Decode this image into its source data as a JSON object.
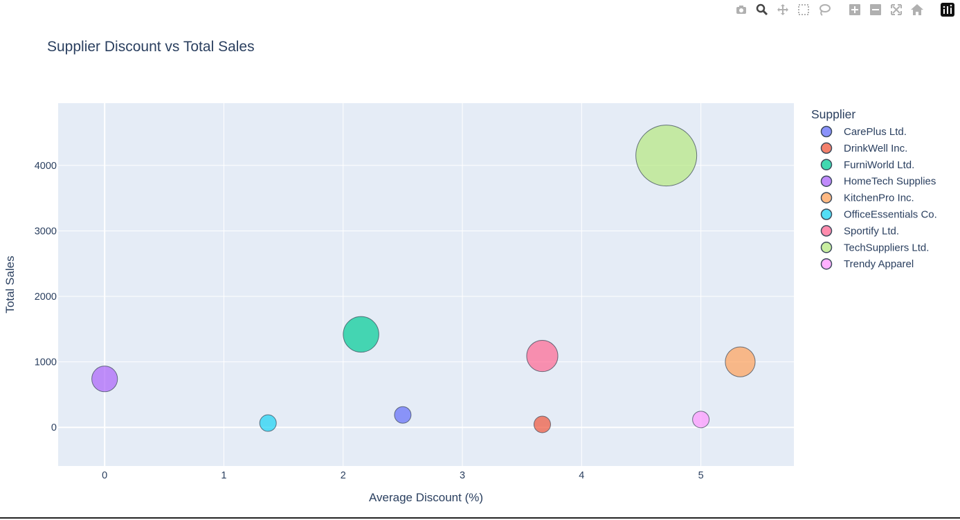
{
  "modebar": {
    "buttons": [
      {
        "name": "camera-icon",
        "label": "Download plot as a png"
      },
      {
        "name": "zoom-icon",
        "label": "Zoom"
      },
      {
        "name": "pan-icon",
        "label": "Pan"
      },
      {
        "name": "box-select-icon",
        "label": "Box Select"
      },
      {
        "name": "lasso-select-icon",
        "label": "Lasso Select"
      },
      {
        "name": "zoom-in-icon",
        "label": "Zoom in"
      },
      {
        "name": "zoom-out-icon",
        "label": "Zoom out"
      },
      {
        "name": "autoscale-icon",
        "label": "Autoscale"
      },
      {
        "name": "reset-axes-icon",
        "label": "Reset axes"
      },
      {
        "name": "plotly-logo-icon",
        "label": "Produced with Plotly"
      }
    ]
  },
  "chart_data": {
    "type": "scatter",
    "title": "Supplier Discount vs Total Sales",
    "xlabel": "Average Discount (%)",
    "ylabel": "Total Sales",
    "legend_title": "Supplier",
    "legend_position": "right",
    "xlim": [
      -0.39,
      5.78
    ],
    "ylim": [
      -590,
      4950
    ],
    "xticks": [
      0,
      1,
      2,
      3,
      4,
      5
    ],
    "yticks": [
      0,
      1000,
      2000,
      3000,
      4000
    ],
    "grid": true,
    "plot_background": "#e5ecf6",
    "bubble_size_meaning": "proportional to total sales",
    "series": [
      {
        "name": "CarePlus Ltd.",
        "color": "#636efa",
        "points": [
          {
            "x": 2.5,
            "y": 190
          }
        ]
      },
      {
        "name": "DrinkWell Inc.",
        "color": "#ef553b",
        "points": [
          {
            "x": 3.67,
            "y": 45
          }
        ]
      },
      {
        "name": "FurniWorld Ltd.",
        "color": "#00cc96",
        "points": [
          {
            "x": 2.15,
            "y": 1420
          }
        ]
      },
      {
        "name": "HomeTech Supplies",
        "color": "#ab63fa",
        "points": [
          {
            "x": 0.0,
            "y": 740
          }
        ]
      },
      {
        "name": "KitchenPro Inc.",
        "color": "#ffa15a",
        "points": [
          {
            "x": 5.33,
            "y": 1000
          }
        ]
      },
      {
        "name": "OfficeEssentials Co.",
        "color": "#19d3f3",
        "points": [
          {
            "x": 1.37,
            "y": 65
          }
        ]
      },
      {
        "name": "Sportify Ltd.",
        "color": "#ff6692",
        "points": [
          {
            "x": 3.67,
            "y": 1090
          }
        ]
      },
      {
        "name": "TechSuppliers Ltd.",
        "color": "#b6e880",
        "points": [
          {
            "x": 4.71,
            "y": 4150
          }
        ]
      },
      {
        "name": "Trendy Apparel",
        "color": "#ff97ff",
        "points": [
          {
            "x": 5.0,
            "y": 120
          }
        ]
      }
    ]
  }
}
